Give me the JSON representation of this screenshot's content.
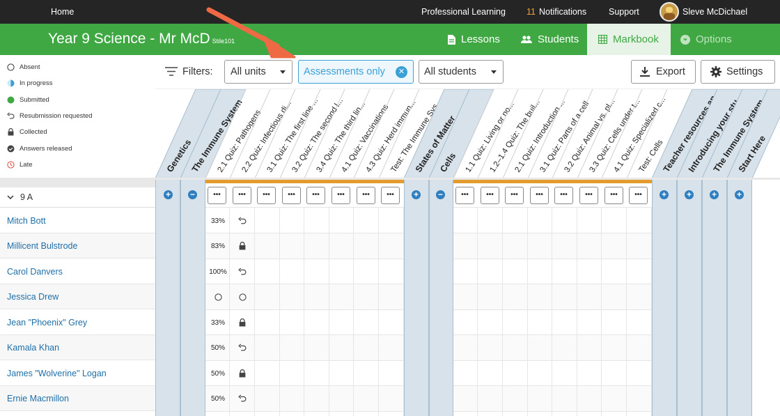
{
  "topbar": {
    "home": "Home",
    "professional_learning": "Professional Learning",
    "notification_count": "11",
    "notifications": "Notifications",
    "support": "Support",
    "user_name": "Sleve McDichael"
  },
  "course": {
    "title": "Year 9 Science - Mr McD",
    "code": "Stile101"
  },
  "tabs": {
    "lessons": "Lessons",
    "students": "Students",
    "markbook": "Markbook",
    "options": "Options"
  },
  "legend": [
    {
      "icon": "empty-circle-icon",
      "label": "Absent"
    },
    {
      "icon": "half-circle-icon",
      "label": "In progress"
    },
    {
      "icon": "filled-green-circle-icon",
      "label": "Submitted"
    },
    {
      "icon": "undo-arrow-icon",
      "label": "Resubmission requested"
    },
    {
      "icon": "lock-icon",
      "label": "Collected"
    },
    {
      "icon": "check-circle-icon",
      "label": "Answers released"
    },
    {
      "icon": "clock-icon",
      "label": "Late"
    }
  ],
  "filters": {
    "label": "Filters:",
    "units": "All units",
    "assessments": "Assessments only",
    "students": "All students",
    "export": "Export",
    "settings": "Settings"
  },
  "column_headers": {
    "genetics": "Genetics",
    "immune": "The Immune System",
    "immune_items": [
      "2.1 Quiz: Pathogens",
      "2.2 Quiz: Infectious di...",
      "3.1 Quiz: The first line ...",
      "3.2 Quiz: The second l...",
      "3.4 Quiz: The third lin...",
      "4.1 Quiz: Vaccinations",
      "4.3 Quiz: Herd immun...",
      "Test: The Immune Sys..."
    ],
    "states": "States of Matter",
    "cells": "Cells",
    "cells_items": [
      "1.1 Quiz: Living or no...",
      "1.2–1.4 Quiz: The buil...",
      "2.1 Quiz: Introduction ...",
      "3.1 Quiz: Parts of a cell",
      "3.2 Quiz: Animal vs. pl...",
      "3.3 Quiz: Cells under t...",
      "4.1 Quiz: Specialized c...",
      "Test: Cells"
    ],
    "teacher": "Teacher resources an...",
    "introducing": "Introducing your stu...",
    "immune2": "The Immune System",
    "start": "Start Here"
  },
  "class_group": "9 A",
  "dots_label": "•••",
  "students": [
    {
      "name": "Mitch Bott",
      "score": "33%",
      "status": "undo-arrow-icon"
    },
    {
      "name": "Millicent Bulstrode",
      "score": "83%",
      "status": "lock-icon"
    },
    {
      "name": "Carol Danvers",
      "score": "100%",
      "status": "undo-arrow-icon"
    },
    {
      "name": "Jessica Drew",
      "score": "",
      "status": "empty-circle-icon"
    },
    {
      "name": "Jean \"Phoenix\" Grey",
      "score": "33%",
      "status": "lock-icon"
    },
    {
      "name": "Kamala Khan",
      "score": "50%",
      "status": "undo-arrow-icon"
    },
    {
      "name": "James \"Wolverine\" Logan",
      "score": "50%",
      "status": "lock-icon"
    },
    {
      "name": "Ernie Macmillon",
      "score": "50%",
      "status": "undo-arrow-icon"
    }
  ],
  "colors": {
    "brand_green": "#3fa843",
    "accent_blue": "#3aa0d8",
    "orange": "#e49b2d",
    "annotation_arrow": "#ee6a45"
  }
}
